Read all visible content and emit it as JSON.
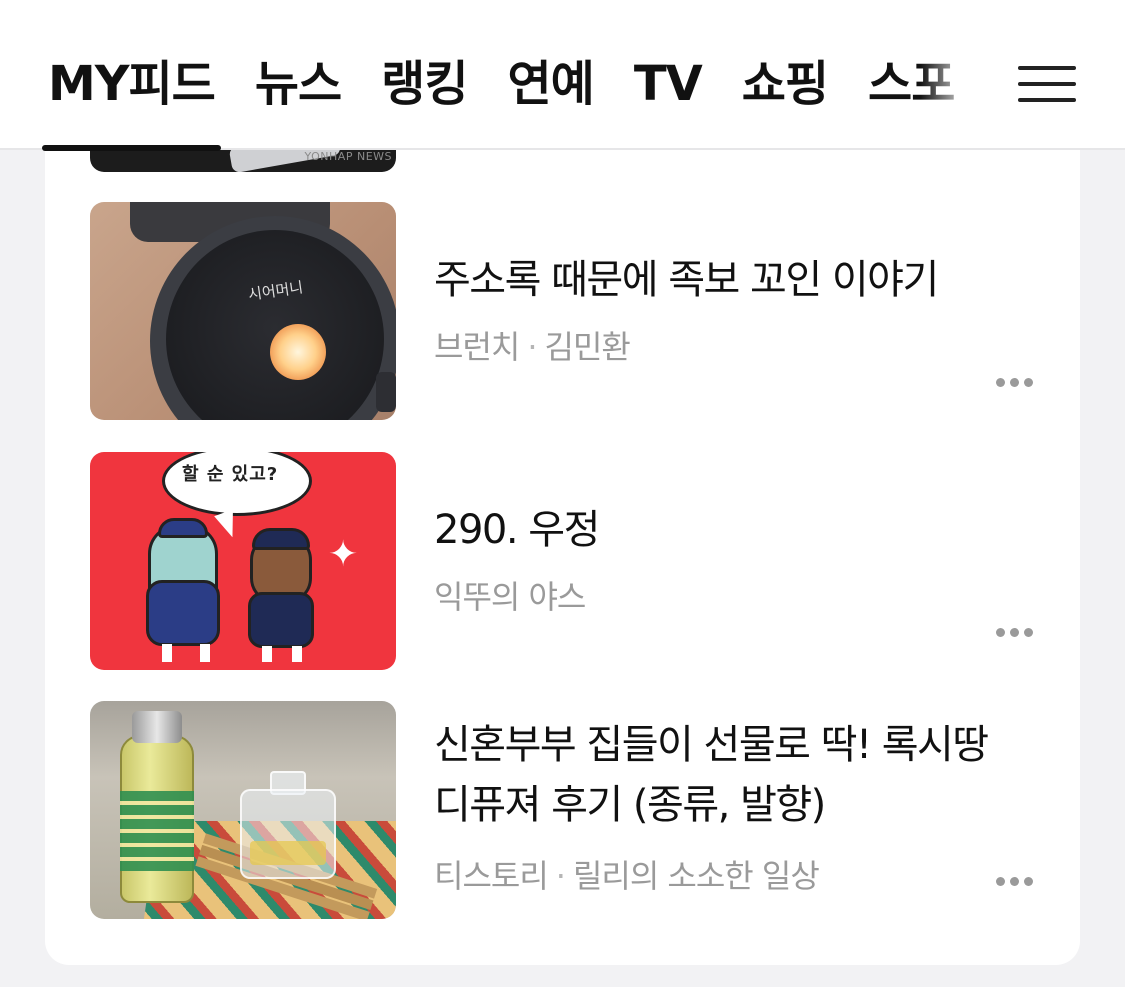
{
  "nav": {
    "tabs": [
      "MY피드",
      "뉴스",
      "랭킹",
      "연예",
      "TV",
      "쇼핑",
      "스포"
    ],
    "active_tab": "MY피드",
    "menu_icon": "hamburger-menu-icon"
  },
  "previous_item": {
    "thumbnail_watermark": "YONHAP NEWS"
  },
  "feed": [
    {
      "title": "주소록 때문에 족보 꼬인 이야기",
      "source": "브런치",
      "author": "김민환",
      "thumbnail_text": "시어머니",
      "more_icon": "more-dots-icon"
    },
    {
      "title": "290. 우정",
      "source": "익뚜의 야스",
      "author": "",
      "thumbnail_text": "할 순 있고?",
      "more_icon": "more-dots-icon"
    },
    {
      "title": "신혼부부 집들이 선물로 딱! 록시땅 디퓨져 후기 (종류, 발향)",
      "source": "티스토리",
      "author": "릴리의 소소한 일상",
      "thumbnail_text": "",
      "more_icon": "more-dots-icon"
    }
  ],
  "colors": {
    "background": "#f2f2f4",
    "card": "#ffffff",
    "text_primary": "#111111",
    "text_meta": "#9a9a9a",
    "comic_red": "#f0353e"
  }
}
